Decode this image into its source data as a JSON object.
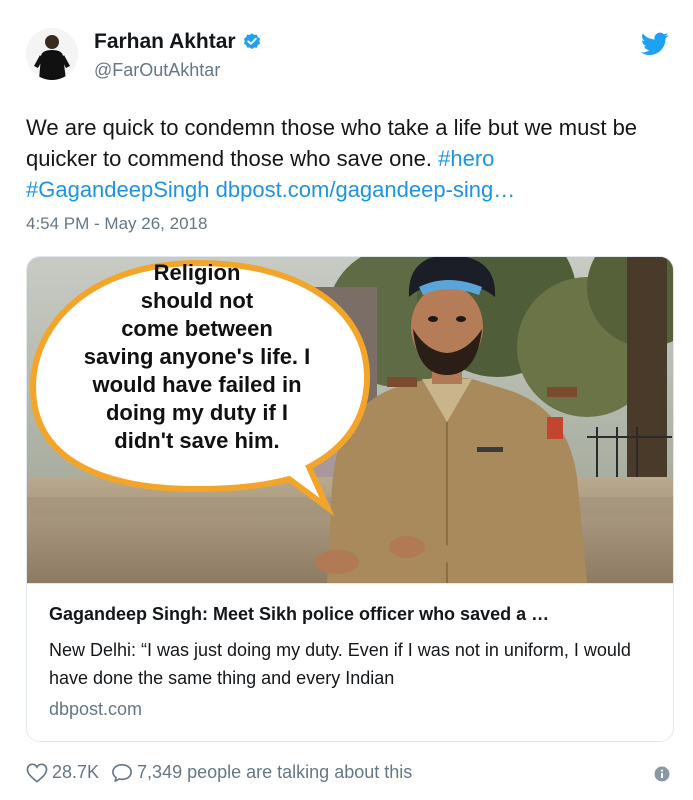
{
  "user": {
    "display_name": "Farhan Akhtar",
    "handle": "@FarOutAkhtar",
    "verified_icon": "verified-badge-icon",
    "brand_color": "#1da1f2"
  },
  "tweet": {
    "text_plain": "We are quick to condemn those who take a life but we must be quicker to commend those who save one. ",
    "hashtag_1": "#hero",
    "hashtag_2": "#GagandeepSingh",
    "link": "dbpost.com/gagandeep-sing…",
    "timestamp": "4:54 PM - May 26, 2018"
  },
  "card": {
    "bubble_lines": [
      "Religion",
      "should not",
      "come between",
      "saving anyone's life. I",
      "would have failed in",
      "doing my duty if I",
      "didn't save him."
    ],
    "title": "Gagandeep Singh: Meet Sikh police officer who saved a …",
    "description": "New Delhi: “I was just doing my duty. Even if I was not in uniform, I would have done the same thing and every Indian",
    "domain": "dbpost.com"
  },
  "actions": {
    "likes": "28.7K",
    "talking": "7,349 people are talking about this"
  }
}
